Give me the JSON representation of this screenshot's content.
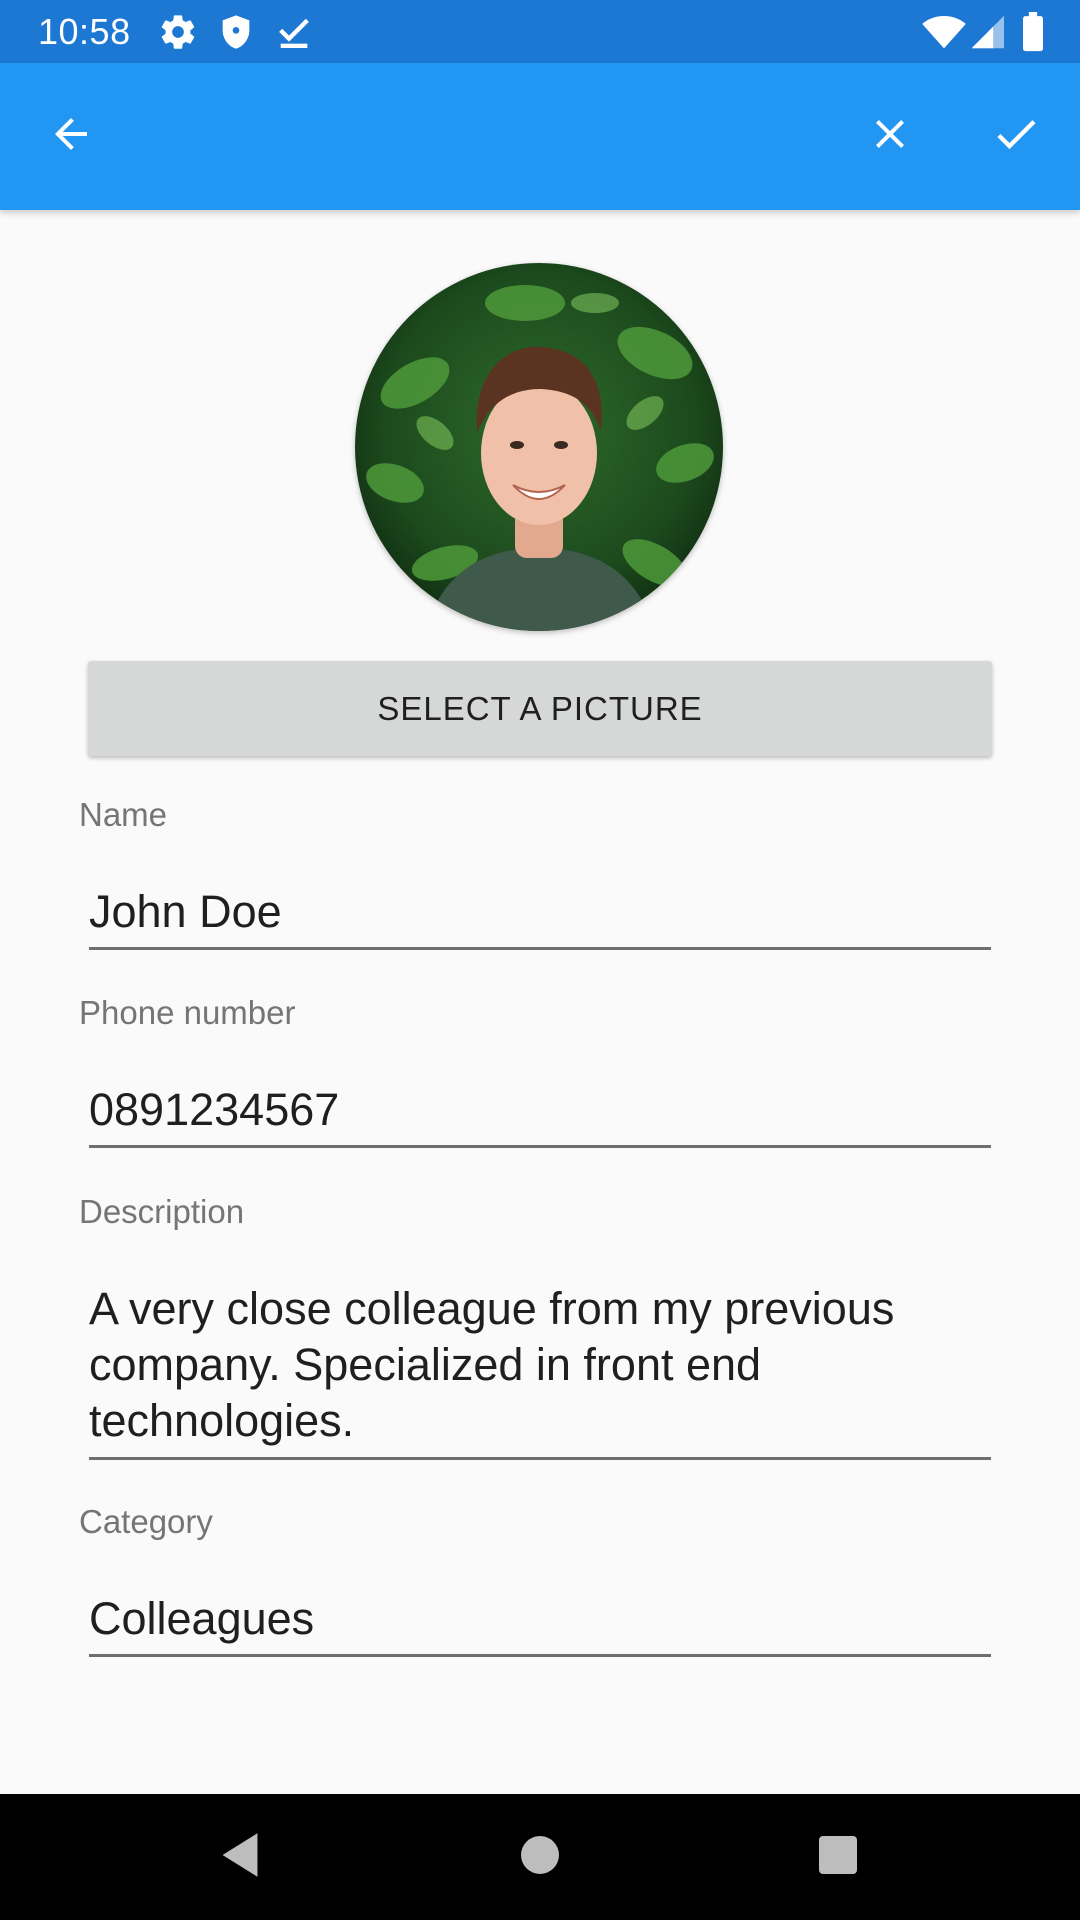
{
  "status_bar": {
    "time": "10:58",
    "left_icons": [
      "gear-icon",
      "shield-icon",
      "download-done-icon"
    ],
    "right_icons": [
      "wifi-icon",
      "cell-signal-icon",
      "battery-icon"
    ]
  },
  "app_bar": {
    "back_icon": "arrow-back-icon",
    "cancel_icon": "close-icon",
    "confirm_icon": "check-icon",
    "color": "#2196f3"
  },
  "avatar": {
    "description_icon": "avatar-photo"
  },
  "select_picture_button": {
    "label": "SELECT A PICTURE"
  },
  "form": {
    "name": {
      "label": "Name",
      "value": "John Doe"
    },
    "phone": {
      "label": "Phone number",
      "value": "0891234567"
    },
    "description": {
      "label": "Description",
      "value": "A very close colleague from my previous company. Specialized in front end technologies."
    },
    "category": {
      "label": "Category",
      "value": "Colleagues"
    }
  },
  "nav_bar": {
    "icons": [
      "nav-back-icon",
      "nav-home-icon",
      "nav-recents-icon"
    ]
  },
  "colors": {
    "status_bar": "#1c78d2",
    "app_bar": "#2196f3",
    "background": "#fafafa",
    "button_bg": "#d6d7d7"
  }
}
